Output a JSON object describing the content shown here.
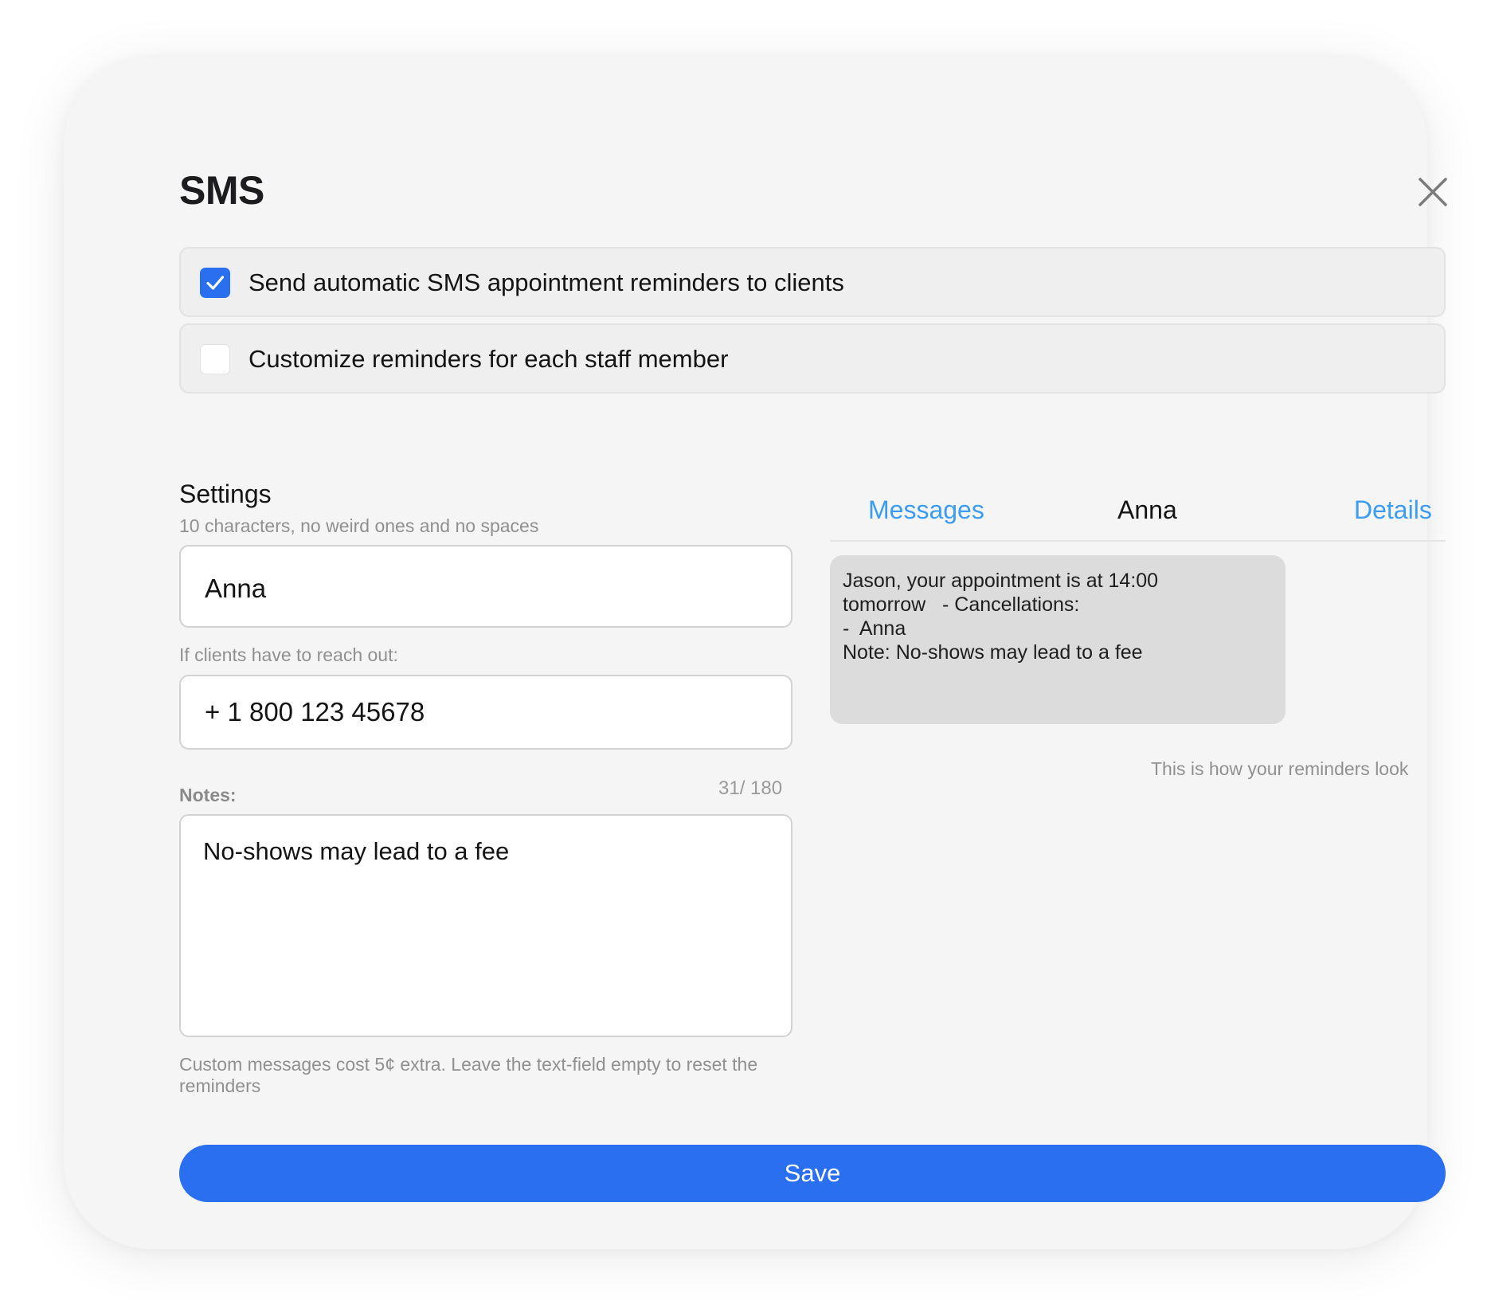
{
  "modal": {
    "title": "SMS"
  },
  "options": [
    {
      "label": "Send automatic SMS appointment reminders to clients",
      "checked": true
    },
    {
      "label": "Customize reminders for each staff member",
      "checked": false
    }
  ],
  "settings": {
    "title": "Settings",
    "sender_hint": "10 characters, no weird ones and no spaces",
    "sender_value": "Anna",
    "phone_hint": "If clients have to reach out:",
    "phone_value": "+ 1 800 123 45678",
    "notes_label": "Notes:",
    "notes_counter": "31/ 180",
    "notes_value": "No-shows may lead to a fee",
    "footer_hint_line1": "Custom messages cost 5¢ extra. Leave the text-field empty to reset the",
    "footer_hint_line2": "reminders"
  },
  "preview": {
    "tabs": [
      {
        "label": "Messages"
      },
      {
        "label": "Anna"
      },
      {
        "label": "Details"
      }
    ],
    "bubble_lines": [
      "Jason, your appointment is at 14:00",
      "tomorrow   - Cancellations:",
      "",
      "-  Anna",
      "",
      "Note: No-shows may lead to a fee"
    ],
    "caption": "This is how your reminders look"
  },
  "save_label": "Save",
  "colors": {
    "accent": "#2a6ff0",
    "link": "#3b9cf2",
    "modal_bg": "#f5f5f5",
    "bubble_bg": "#dcdcdc"
  },
  "icons": {
    "close": "close-icon",
    "check": "checkmark-icon"
  }
}
